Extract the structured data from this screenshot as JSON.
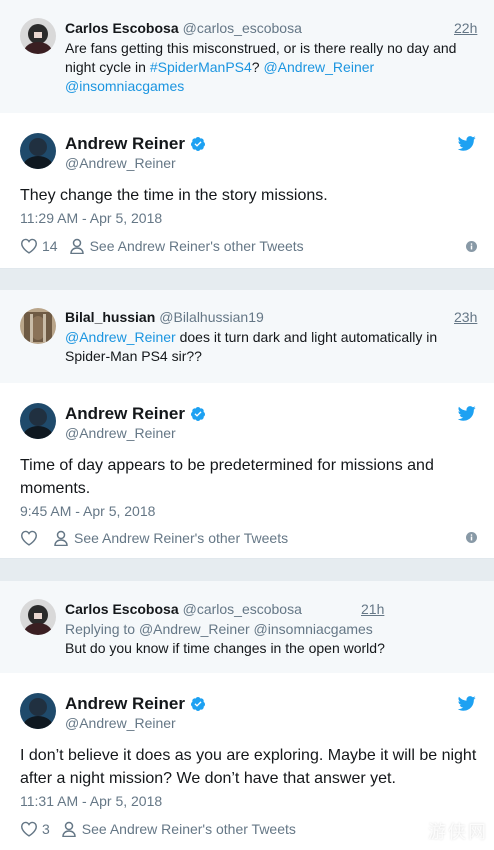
{
  "threads": [
    {
      "reply": {
        "name": "Carlos Escobosa",
        "handle": "@carlos_escobosa",
        "time": "22h",
        "text_plain_1": "Are fans getting this misconstrued, or is there really no day and night cycle in ",
        "hashtag": "#SpiderManPS4",
        "text_plain_2": "? ",
        "mention_1": "@Andrew_Reiner",
        "mention_2": "@insomniacgames"
      },
      "tweet": {
        "name": "Andrew Reiner",
        "handle": "@Andrew_Reiner",
        "text": "They change the time in the story missions.",
        "datetime": "11:29 AM - Apr 5, 2018",
        "likes": "14",
        "other_tweets_label": "See Andrew Reiner's other Tweets"
      }
    },
    {
      "reply": {
        "name": "Bilal_hussian",
        "handle": "@Bilalhussian19",
        "time": "23h",
        "mention": "@Andrew_Reiner",
        "text_plain": " does it turn dark and light automatically in Spider-Man PS4 sir??"
      },
      "tweet": {
        "name": "Andrew Reiner",
        "handle": "@Andrew_Reiner",
        "text": "Time of day appears to be predetermined for missions and moments.",
        "datetime": "9:45 AM - Apr 5, 2018",
        "likes": "",
        "other_tweets_label": "See Andrew Reiner's other Tweets"
      }
    },
    {
      "reply": {
        "name": "Carlos Escobosa",
        "handle": "@carlos_escobosa",
        "time": "21h",
        "replying_prefix": "Replying to ",
        "replying_to_1": "@Andrew_Reiner",
        "replying_to_2": "@insomniacgames",
        "text": "But do you know if time changes in the open world?"
      },
      "tweet": {
        "name": "Andrew Reiner",
        "handle": "@Andrew_Reiner",
        "text": "I don’t believe it does as you are exploring. Maybe it will be night after a night mission? We don’t have that answer yet.",
        "datetime": "11:31 AM - Apr 5, 2018",
        "likes": "3",
        "other_tweets_label": "See Andrew Reiner's other Tweets"
      }
    }
  ],
  "watermark": "游侠网",
  "colors": {
    "link": "#1b95e0",
    "muted": "#657786",
    "verified": "#1da1f2",
    "reply_bg": "#f5f8fa",
    "page_bg": "#e6ecf0"
  },
  "icons": [
    "verified-badge-icon",
    "twitter-bird-icon",
    "heart-icon",
    "person-icon",
    "info-icon"
  ]
}
